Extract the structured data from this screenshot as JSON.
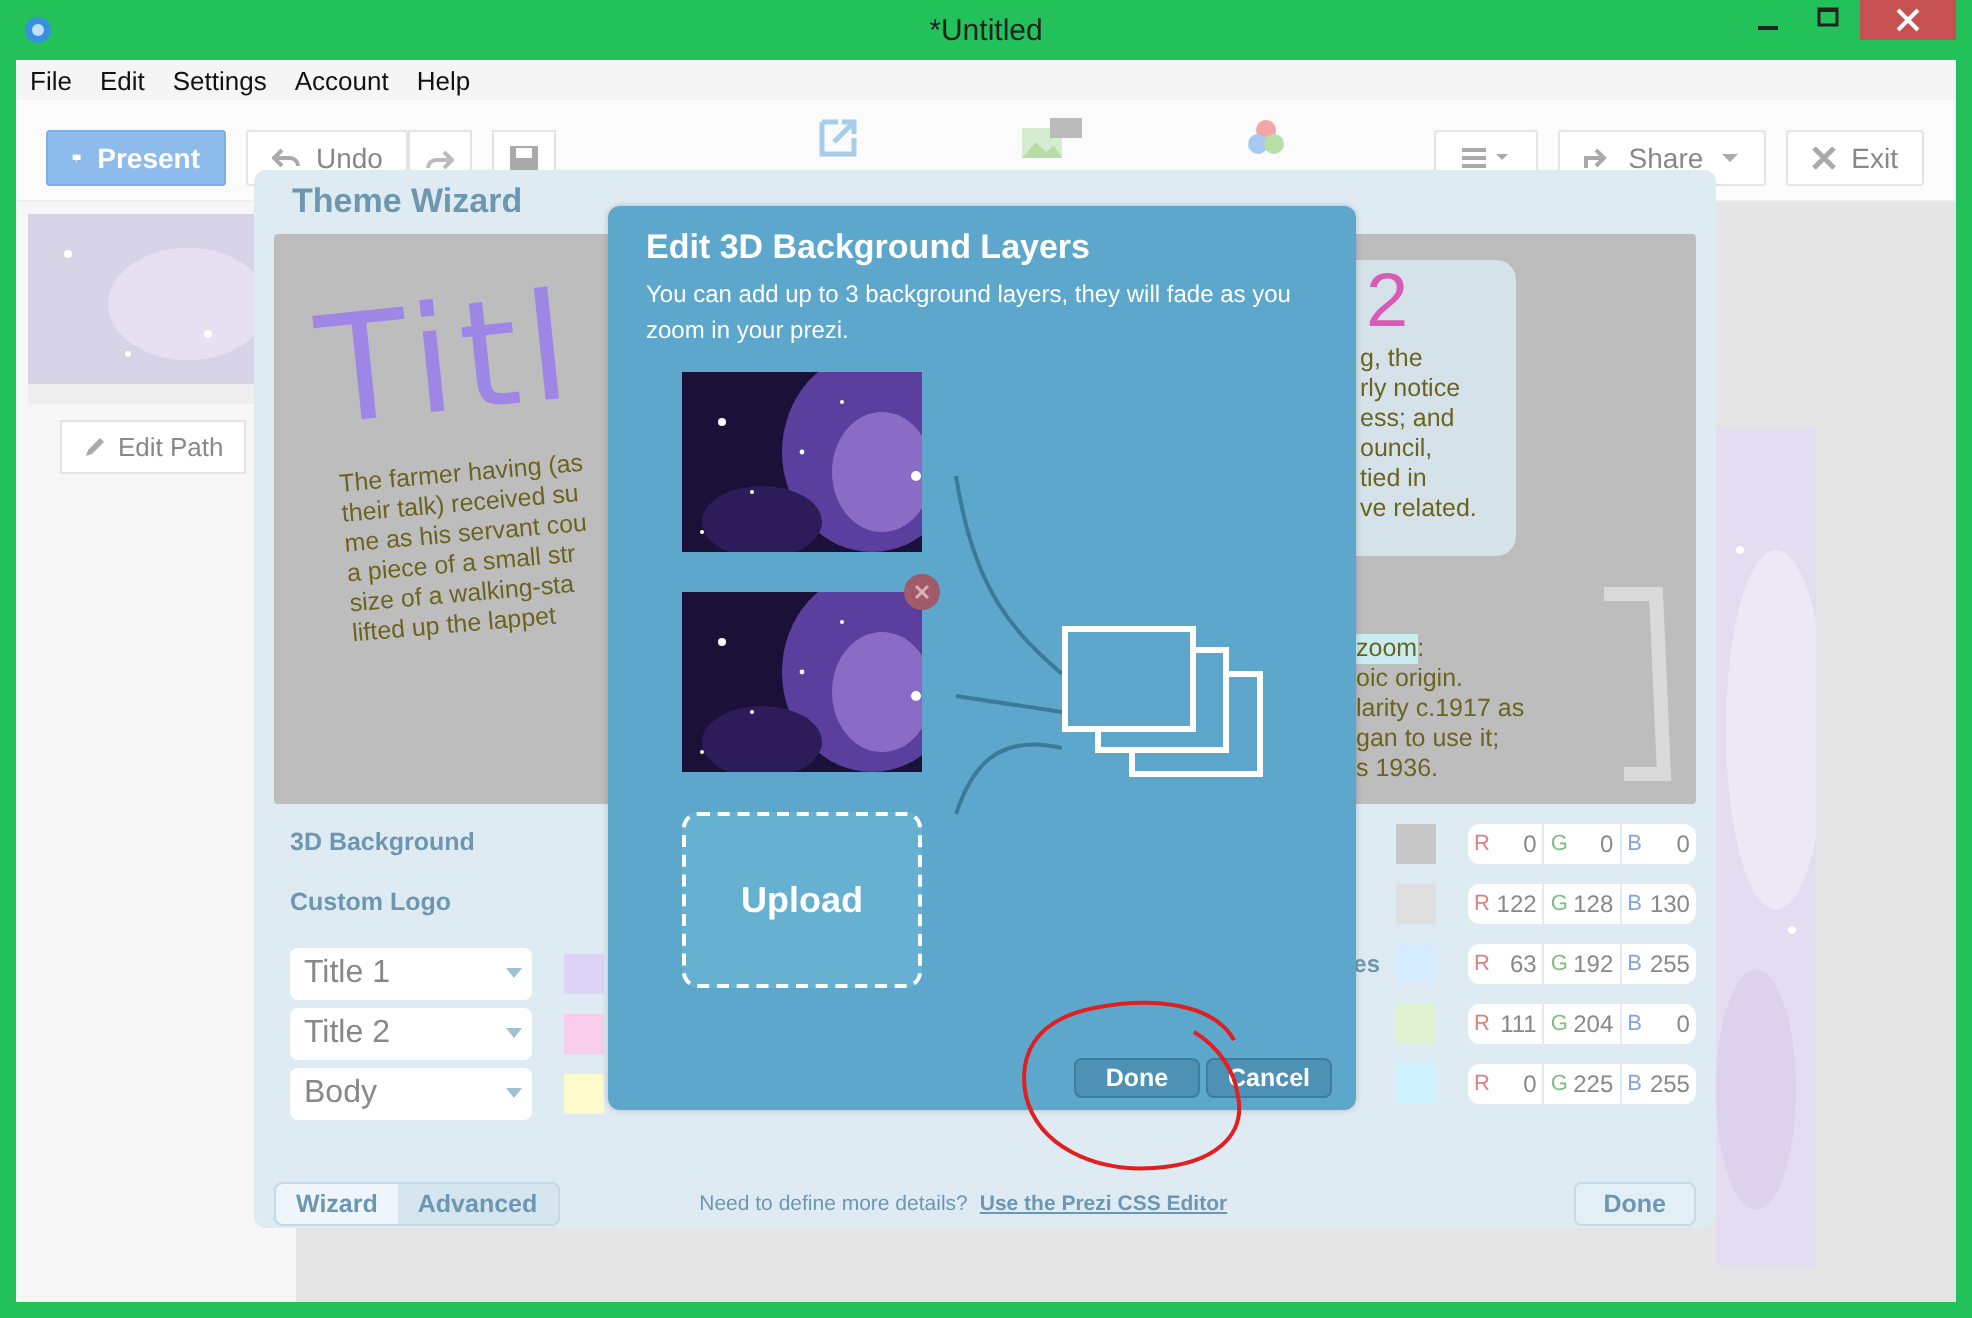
{
  "window": {
    "title": "*Untitled"
  },
  "menu": [
    "File",
    "Edit",
    "Settings",
    "Account",
    "Help"
  ],
  "toolbar": {
    "present": {
      "label": "Present",
      "selected": true
    },
    "undo": "Undo",
    "share": "Share",
    "exit": "Exit"
  },
  "sidebar": {
    "edit_path": "Edit Path"
  },
  "theme_wizard": {
    "title": "Theme Wizard",
    "preview": {
      "title": "Titl",
      "body_left": [
        "The farmer having (as",
        "their talk) received su",
        "me as his servant cou",
        "a piece of a small str",
        "size of a walking-sta",
        "lifted up the lappet"
      ],
      "title_2": "2",
      "body_right_top": [
        "g, the",
        "rly notice",
        "ess; and",
        "ouncil,",
        "tied in",
        "ve related."
      ],
      "highlighted": "zoom",
      "after_highlight": ":",
      "body_right_bottom": [
        "oic origin.",
        "larity c.1917 as",
        "gan to use it;",
        "s 1936."
      ]
    },
    "labels": [
      "3D Background",
      "Custom Logo"
    ],
    "fonts": [
      {
        "label": "Title 1",
        "color": "#dcd3f5"
      },
      {
        "label": "Title 2",
        "color": "#f8cdea"
      },
      {
        "label": "Body",
        "color": "#fdfbcb"
      }
    ],
    "color_rows": [
      {
        "color": "#c8c8c8",
        "channels": [
          {
            "label": "R",
            "value": "0"
          },
          {
            "label": "G",
            "value": "0"
          },
          {
            "label": "B",
            "value": "0"
          }
        ]
      },
      {
        "color": "#e0e0e0",
        "channels": [
          {
            "label": "R",
            "value": "122"
          },
          {
            "label": "G",
            "value": "128"
          },
          {
            "label": "B",
            "value": "130"
          }
        ]
      },
      {
        "label": "es",
        "color": "#d6ecff",
        "channels": [
          {
            "label": "R",
            "value": "63"
          },
          {
            "label": "G",
            "value": "192"
          },
          {
            "label": "B",
            "value": "255"
          }
        ]
      },
      {
        "color": "#e1f2d1",
        "channels": [
          {
            "label": "R",
            "value": "111"
          },
          {
            "label": "G",
            "value": "204"
          },
          {
            "label": "B",
            "value": "0"
          }
        ]
      },
      {
        "color": "#ccf3ff",
        "channels": [
          {
            "label": "R",
            "value": "0"
          },
          {
            "label": "G",
            "value": "225"
          },
          {
            "label": "B",
            "value": "255"
          }
        ]
      }
    ],
    "tabs": [
      {
        "label": "Wizard",
        "selected": true
      },
      {
        "label": "Advanced",
        "selected": false
      }
    ],
    "hint": "Need to define more details?",
    "link": "Use the Prezi CSS Editor",
    "done": "Done"
  },
  "dialog": {
    "title": "Edit 3D Background Layers",
    "description": "You can add up to 3 background layers, they will fade as you zoom in your prezi.",
    "layers": [
      {
        "kind": "picture",
        "removable": false
      },
      {
        "kind": "picture",
        "removable": true
      },
      {
        "kind": "upload",
        "label": "Upload"
      }
    ],
    "done": "Done",
    "cancel": "Cancel"
  }
}
